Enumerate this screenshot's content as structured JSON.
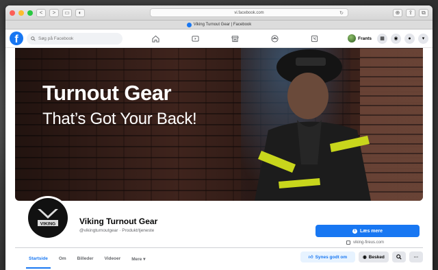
{
  "browser": {
    "url": "vi.facebook.com",
    "tab_title": "Viking Turnout Gear | Facebook",
    "back": "<",
    "forward": ">"
  },
  "header": {
    "search_placeholder": "Søg på Facebook",
    "profile_name": "Frants"
  },
  "cover": {
    "headline": "Turnout Gear",
    "subheadline": "That’s Got Your Back!"
  },
  "page": {
    "name": "Viking Turnout Gear",
    "subtitle": "@vikingturnoutgear · Produkt/tjeneste",
    "learn_more": "Læs mere",
    "website": "viking-fireus.com",
    "logo_text": "VIKING"
  },
  "tabs": [
    "Startside",
    "Om",
    "Billeder",
    "Videoer",
    "Mere ▾"
  ],
  "actions": {
    "like": "Synes godt om",
    "message": "Besked"
  },
  "colors": {
    "brand": "#1877f2"
  }
}
